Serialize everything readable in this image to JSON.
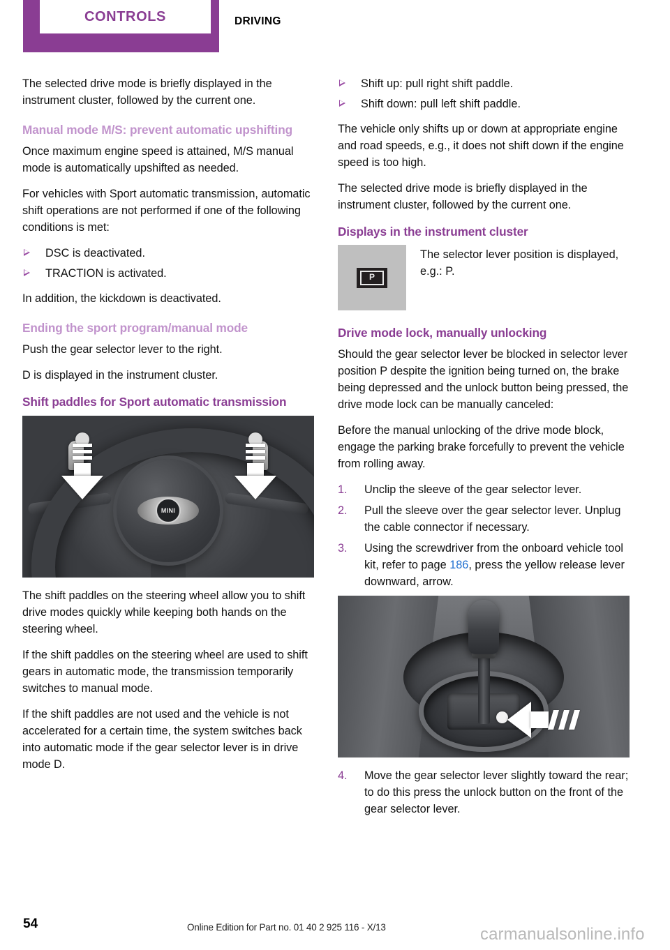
{
  "header": {
    "active_tab": "CONTROLS",
    "inactive_tab": "DRIVING",
    "accent_color": "#8a3d93"
  },
  "left_column": {
    "intro_paragraph": "The selected drive mode is briefly displayed in the instrument cluster, followed by the current one.",
    "heading_manual_mode": "Manual mode M/S: prevent automatic upshifting",
    "manual_mode_p1": "Once maximum engine speed is attained, M/S manual mode is automatically upshifted as needed.",
    "manual_mode_p2": "For vehicles with Sport automatic transmission, automatic shift operations are not performed if one of the following conditions is met:",
    "conditions": [
      "DSC is deactivated.",
      "TRACTION is activated."
    ],
    "kickdown_note": "In addition, the kickdown is deactivated.",
    "heading_ending_sport": "Ending the sport program/manual mode",
    "ending_p1": "Push the gear selector lever to the right.",
    "ending_p2": "D is displayed in the instrument cluster.",
    "heading_shift_paddles": "Shift paddles for Sport automatic transmission",
    "figure_wheel_alt": "MINI steering wheel with shift paddles, white arrows indicating pull direction",
    "wheel_logo_text": "MINI",
    "paddles_p1": "The shift paddles on the steering wheel allow you to shift drive modes quickly while keeping both hands on the steering wheel.",
    "paddles_p2": "If the shift paddles on the steering wheel are used to shift gears in automatic mode, the transmission temporarily switches to manual mode.",
    "paddles_p3": "If the shift paddles are not used and the vehicle is not accelerated for a certain time, the system switches back into automatic mode if the gear selector lever is in drive mode D."
  },
  "right_column": {
    "shift_bullets": [
      "Shift up: pull right shift paddle.",
      "Shift down: pull left shift paddle."
    ],
    "vehicle_speed_note": "The vehicle only shifts up or down at appropriate engine and road speeds, e.g., it does not shift down if the engine speed is too high.",
    "drive_mode_note": "The selected drive mode is briefly displayed in the instrument cluster, followed by the current one.",
    "heading_displays": "Displays in the instrument cluster",
    "p_badge_label": "P",
    "selector_lever_text": "The selector lever position is displayed, e.g.: P.",
    "heading_drive_mode_lock": "Drive mode lock, manually unlocking",
    "lock_p1": "Should the gear selector lever be blocked in selector lever position P despite the ignition being turned on, the brake being depressed and the unlock button being pressed, the drive mode lock can be manually canceled:",
    "lock_p2": "Before the manual unlocking of the drive mode block, engage the parking brake forcefully to prevent the vehicle from rolling away.",
    "steps": [
      {
        "number": "1.",
        "text": "Unclip the sleeve of the gear selector lever."
      },
      {
        "number": "2.",
        "text": "Pull the sleeve over the gear selector lever. Unplug the cable connector if necessary."
      }
    ],
    "step3": {
      "number": "3.",
      "text_before": "Using the screwdriver from the onboard vehicle tool kit, refer to page ",
      "link": "186",
      "text_after": ", press the yellow release lever downward, arrow."
    },
    "figure_lever_alt": "Gear selector lever base with white arrow pointing at the yellow release lever",
    "step4": {
      "number": "4.",
      "text": "Move the gear selector lever slightly toward the rear; to do this press the unlock button on the front of the gear selector lever."
    },
    "link_color": "#1f6fd0"
  },
  "footer": {
    "page_number": "54",
    "edition_note": "Online Edition for Part no. 01 40 2 925 116 - X/13",
    "watermark": "carmanualsonline.info"
  }
}
